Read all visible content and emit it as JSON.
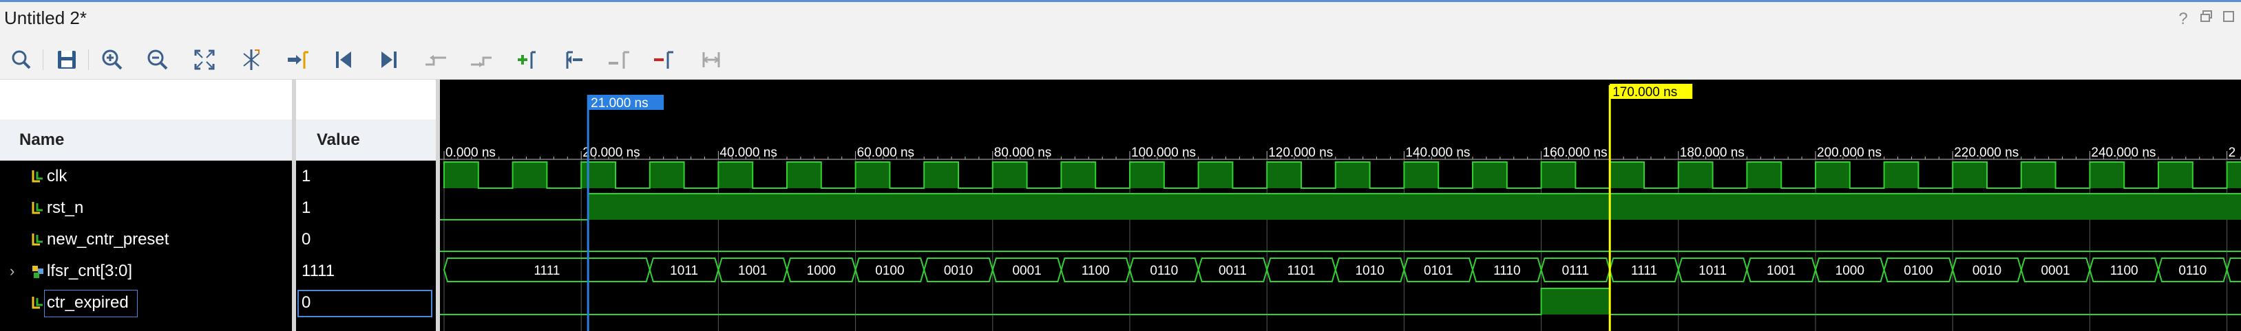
{
  "window": {
    "title": "Untitled 2*",
    "controls": [
      "?",
      "restore",
      "maximize"
    ]
  },
  "toolbar": {
    "buttons": [
      {
        "name": "search-icon",
        "tip": "Search"
      },
      {
        "name": "save-icon",
        "tip": "Save Waveform Configuration"
      },
      {
        "name": "zoom-in-icon",
        "tip": "Zoom In"
      },
      {
        "name": "zoom-out-icon",
        "tip": "Zoom Out"
      },
      {
        "name": "zoom-fit-icon",
        "tip": "Zoom Fit"
      },
      {
        "name": "zoom-to-cursor-icon",
        "tip": "Zoom to Cursor"
      },
      {
        "name": "go-to-cursor-icon",
        "tip": "Go to Cursor"
      },
      {
        "name": "go-to-time-0-icon",
        "tip": "Go to Time 0"
      },
      {
        "name": "go-to-last-time-icon",
        "tip": "Go to Last Time"
      },
      {
        "name": "previous-transition-icon",
        "tip": "Previous Transition"
      },
      {
        "name": "next-transition-icon",
        "tip": "Next Transition"
      },
      {
        "name": "add-marker-icon",
        "tip": "Add Marker"
      },
      {
        "name": "previous-marker-icon",
        "tip": "Previous Marker"
      },
      {
        "name": "next-marker-icon",
        "tip": "Next Marker"
      },
      {
        "name": "swap-cursors-icon",
        "tip": "Swap Cursors"
      },
      {
        "name": "snap-to-transition-icon",
        "tip": "Snap to Transition"
      }
    ]
  },
  "columns": {
    "name": "Name",
    "value": "Value"
  },
  "signals": [
    {
      "name": "clk",
      "value": "1",
      "kind": "bit"
    },
    {
      "name": "rst_n",
      "value": "1",
      "kind": "bit"
    },
    {
      "name": "new_cntr_preset",
      "value": "0",
      "kind": "bit"
    },
    {
      "name": "lfsr_cnt[3:0]",
      "value": "1111",
      "kind": "bus",
      "expandable": true
    },
    {
      "name": "ctr_expired",
      "value": "0",
      "kind": "bit",
      "selected": true
    }
  ],
  "cursor": {
    "label": "21.000 ns",
    "time": 21
  },
  "marker": {
    "label": "170.000 ns",
    "time": 170
  },
  "timeline": {
    "unit": "ns",
    "ticks": [
      {
        "t": 0,
        "label": "0.000 ns"
      },
      {
        "t": 20,
        "label": "20.000 ns"
      },
      {
        "t": 40,
        "label": "40.000 ns"
      },
      {
        "t": 60,
        "label": "60.000 ns"
      },
      {
        "t": 80,
        "label": "80.000 ns"
      },
      {
        "t": 100,
        "label": "100.000 ns"
      },
      {
        "t": 120,
        "label": "120.000 ns"
      },
      {
        "t": 140,
        "label": "140.000 ns"
      },
      {
        "t": 160,
        "label": "160.000 ns"
      },
      {
        "t": 180,
        "label": "180.000 ns"
      },
      {
        "t": 200,
        "label": "200.000 ns"
      },
      {
        "t": 220,
        "label": "220.000 ns"
      },
      {
        "t": 240,
        "label": "240.000 ns"
      },
      {
        "t": 260,
        "label": "2"
      }
    ]
  },
  "waves": {
    "clk": {
      "period": 10,
      "high_first": true
    },
    "rst_n": {
      "rise_time": 21
    },
    "new_cntr_preset": {
      "constant": 0
    },
    "ctr_expired": {
      "high_start": 160,
      "high_end": 170
    },
    "lfsr_cnt": [
      {
        "start": 0,
        "end": 30,
        "label": "1111"
      },
      {
        "start": 30,
        "end": 40,
        "label": "1011"
      },
      {
        "start": 40,
        "end": 50,
        "label": "1001"
      },
      {
        "start": 50,
        "end": 60,
        "label": "1000"
      },
      {
        "start": 60,
        "end": 70,
        "label": "0100"
      },
      {
        "start": 70,
        "end": 80,
        "label": "0010"
      },
      {
        "start": 80,
        "end": 90,
        "label": "0001"
      },
      {
        "start": 90,
        "end": 100,
        "label": "1100"
      },
      {
        "start": 100,
        "end": 110,
        "label": "0110"
      },
      {
        "start": 110,
        "end": 120,
        "label": "0011"
      },
      {
        "start": 120,
        "end": 130,
        "label": "1101"
      },
      {
        "start": 130,
        "end": 140,
        "label": "1010"
      },
      {
        "start": 140,
        "end": 150,
        "label": "0101"
      },
      {
        "start": 150,
        "end": 160,
        "label": "1110"
      },
      {
        "start": 160,
        "end": 170,
        "label": "0111"
      },
      {
        "start": 170,
        "end": 180,
        "label": "1111"
      },
      {
        "start": 180,
        "end": 190,
        "label": "1011"
      },
      {
        "start": 190,
        "end": 200,
        "label": "1001"
      },
      {
        "start": 200,
        "end": 210,
        "label": "1000"
      },
      {
        "start": 210,
        "end": 220,
        "label": "0100"
      },
      {
        "start": 220,
        "end": 230,
        "label": "0010"
      },
      {
        "start": 230,
        "end": 240,
        "label": "0001"
      },
      {
        "start": 240,
        "end": 250,
        "label": "1100"
      },
      {
        "start": 250,
        "end": 260,
        "label": "0110"
      },
      {
        "start": 260,
        "end": 270,
        "label": ""
      }
    ]
  },
  "colors": {
    "wave_green": "#2fd22f",
    "wave_fill": "#0d6b0d",
    "cursor_blue": "#2b7fe0",
    "marker_yellow": "#ffff00",
    "grid": "#5a5a5a"
  }
}
